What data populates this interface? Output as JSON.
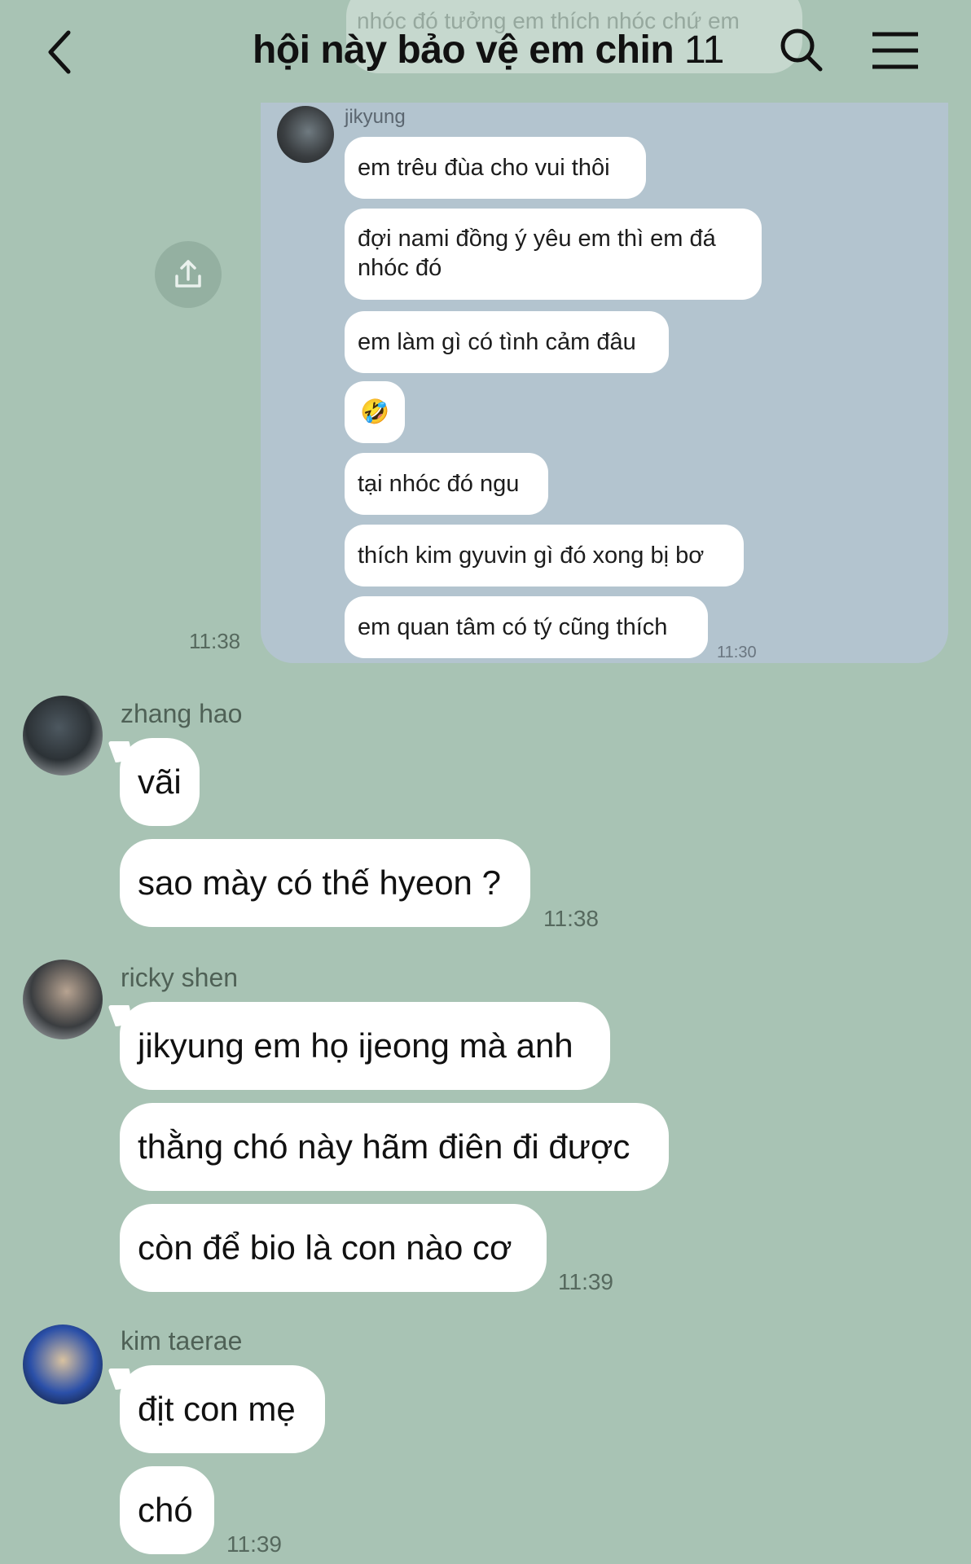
{
  "header": {
    "ghost_text": "nhóc đó tưởng em thích nhóc chứ em",
    "title": "hội này bảo vệ em chin",
    "member_count": "11"
  },
  "forwarded": {
    "sender": "jikyung",
    "messages": [
      "em trêu đùa cho vui thôi",
      "đợi nami đồng ý yêu em thì em đá nhóc đó",
      "em làm gì có tình cảm đâu",
      "🤣",
      "tại nhóc đó ngu",
      "thích kim gyuvin gì đó xong bị bơ",
      "em quan tâm có tý cũng thích"
    ],
    "inner_time": "11:30",
    "time": "11:38"
  },
  "groups": [
    {
      "sender": "zhang hao",
      "messages": [
        "vãi",
        "sao mày có thế hyeon ?"
      ],
      "time": "11:38"
    },
    {
      "sender": "ricky shen",
      "messages": [
        "jikyung em họ ijeong mà anh",
        "thằng chó này hãm điên đi được",
        "còn để bio là con nào cơ"
      ],
      "time": "11:39"
    },
    {
      "sender": "kim taerae",
      "messages": [
        "địt con mẹ",
        "chó"
      ],
      "time": "11:39"
    }
  ],
  "icons": {
    "back": "chevron-left-icon",
    "search": "search-icon",
    "menu": "hamburger-menu-icon",
    "share": "share-icon"
  },
  "colors": {
    "background": "#a8c3b4",
    "bubble": "#ffffff",
    "forward_card": "#b3c4cf"
  }
}
